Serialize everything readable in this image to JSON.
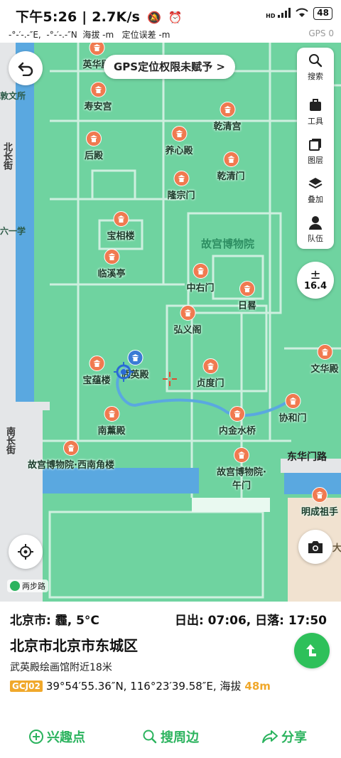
{
  "status": {
    "time": "下午5:26",
    "net_speed": "2.7K/s",
    "separator": "|",
    "signal_tag": "HD",
    "battery": "48"
  },
  "gps_info": {
    "text": "-°-′-.-″E,  -°-′-.-″N  海拔 -m   定位误差 -m",
    "right_label": "GPS",
    "right_value": "0"
  },
  "map": {
    "gps_banner": "GPS定位权限未赋予 >",
    "zoom": "16.4",
    "tools": [
      {
        "label": "搜索",
        "icon": "search-icon"
      },
      {
        "label": "工具",
        "icon": "toolbox-icon"
      },
      {
        "label": "图层",
        "icon": "layers-icon"
      },
      {
        "label": "叠加",
        "icon": "overlay-icon"
      },
      {
        "label": "队伍",
        "icon": "team-icon"
      }
    ],
    "area_label": "故宫博物院",
    "pois": [
      {
        "name": "英华殿"
      },
      {
        "name": "寿安宫"
      },
      {
        "name": "乾清宫"
      },
      {
        "name": "后殿"
      },
      {
        "name": "养心殿"
      },
      {
        "name": "乾清门"
      },
      {
        "name": "隆宗门"
      },
      {
        "name": "宝相楼"
      },
      {
        "name": "临溪亭"
      },
      {
        "name": "中右门"
      },
      {
        "name": "日晷"
      },
      {
        "name": "弘义阁"
      },
      {
        "name": "宝蕴楼"
      },
      {
        "name": "武英殿"
      },
      {
        "name": "贞度门"
      },
      {
        "name": "文华殿"
      },
      {
        "name": "协和门"
      },
      {
        "name": "南薰殿"
      },
      {
        "name": "内金水桥"
      },
      {
        "name": "故宫博物院·西南角楼"
      },
      {
        "name": "故宫博物院·午门"
      },
      {
        "name": "明成祖手"
      }
    ],
    "edge_labels": {
      "left_top": "敦文所",
      "left_mid1": "北长街",
      "left_mid2": "六一学",
      "left_road": "南长街",
      "east_gate": "东华门路",
      "corner_da": "大"
    },
    "logo_text": "两步路"
  },
  "info": {
    "weather": "北京市: 霾, 5°C",
    "sun": "日出: 07:06, 日落: 17:50",
    "district": "北京市北京市东城区",
    "nearby": "武英殿绘画馆附近18米",
    "coord_system": "GCJ02",
    "coords": "39°54′55.36″N, 116°23′39.58″E, 海拔",
    "altitude": "48m"
  },
  "actions": [
    {
      "label": "兴趣点",
      "icon": "plus-circle-icon"
    },
    {
      "label": "搜周边",
      "icon": "search-icon"
    },
    {
      "label": "分享",
      "icon": "share-icon"
    }
  ],
  "colors": {
    "map_green": "#6fd3a0",
    "accent_green": "#2bb35e",
    "poi_orange": "#f07a50",
    "altitude_orange": "#f0a82b",
    "water_blue": "#5aa8e0"
  }
}
